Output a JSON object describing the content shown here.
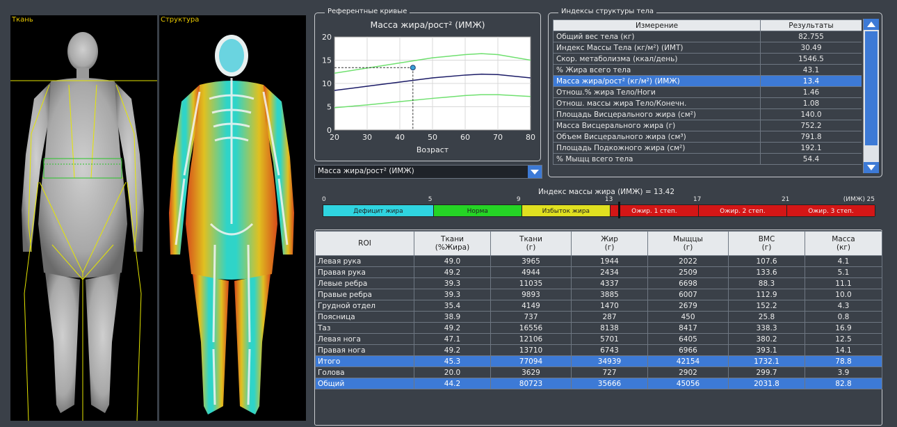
{
  "panels": {
    "tissue_label": "Ткань",
    "structure_label": "Структура"
  },
  "ref_curves": {
    "group_title": "Референтные кривые",
    "chart_title": "Масса жира/рост² (ИМЖ)",
    "xlabel": "Возраст",
    "xticks": [
      "20",
      "30",
      "40",
      "50",
      "60",
      "70",
      "80"
    ],
    "yticks": [
      "0",
      "5",
      "10",
      "15",
      "20"
    ]
  },
  "chart_data": {
    "type": "line",
    "title": "Масса жира/рост² (ИМЖ)",
    "xlabel": "Возраст",
    "ylabel": "",
    "xlim": [
      20,
      80
    ],
    "ylim": [
      0,
      20
    ],
    "x": [
      20,
      30,
      40,
      50,
      60,
      65,
      70,
      80
    ],
    "series": [
      {
        "values": [
          12.2,
          13.3,
          14.4,
          15.5,
          16.2,
          16.4,
          16.2,
          15.0
        ],
        "color": "#6fe06f"
      },
      {
        "values": [
          8.5,
          9.4,
          10.3,
          11.2,
          11.8,
          12.0,
          11.9,
          11.2
        ],
        "color": "#1a1a66"
      },
      {
        "values": [
          4.8,
          5.4,
          6.1,
          6.8,
          7.4,
          7.6,
          7.6,
          7.2
        ],
        "color": "#6fe06f"
      }
    ],
    "patient_point": {
      "x": 44,
      "y": 13.4
    },
    "grid": true
  },
  "dropdown": {
    "value": "Масса жира/рост² (ИМЖ)"
  },
  "indices": {
    "group_title": "Индексы структуры тела",
    "col_measure": "Измерение",
    "col_result": "Результаты",
    "rows": [
      {
        "name": "Общий вес тела (кг)",
        "value": "82.755"
      },
      {
        "name": "Индекс Массы Тела (кг/м²) (ИМТ)",
        "value": "30.49"
      },
      {
        "name": "Скор. метаболизма (ккал/день)",
        "value": "1546.5"
      },
      {
        "name": "% Жира всего тела",
        "value": "43.1"
      },
      {
        "name": "Масса жира/рост² (кг/м²) (ИМЖ)",
        "value": "13.4"
      },
      {
        "name": "Отнош.% жира Тело/Ноги",
        "value": "1.46"
      },
      {
        "name": "Отнош. массы жира Тело/Конечн.",
        "value": "1.08"
      },
      {
        "name": "Площадь Висцерального жира (см²)",
        "value": "140.0"
      },
      {
        "name": "Масса Висцерального жира (г)",
        "value": "752.2"
      },
      {
        "name": "Объем Висцерального жира (см³)",
        "value": "791.8"
      },
      {
        "name": "Площадь Подкожного жира (см²)",
        "value": "192.1"
      },
      {
        "name": "% Мыщц всего тела",
        "value": "54.4"
      }
    ]
  },
  "fat_scale": {
    "title": "Индекс массы жира (ИМЖ) = 13.42",
    "marker_value": 13.42,
    "unit": "(ИМЖ)",
    "ticks": [
      "0",
      "5",
      "9",
      "13",
      "17",
      "21",
      "25"
    ],
    "segments": [
      {
        "label": "Дефицит жира",
        "color": "#2fd4e0"
      },
      {
        "label": "Норма",
        "color": "#25d425"
      },
      {
        "label": "Избыток жира",
        "color": "#e0e020"
      },
      {
        "label": "Ожир. 1 степ.",
        "color": "#d41616"
      },
      {
        "label": "Ожир. 2 степ.",
        "color": "#d41616"
      },
      {
        "label": "Ожир. 3 степ.",
        "color": "#d41616"
      }
    ]
  },
  "roi": {
    "headers": [
      "ROI",
      "Ткани\n(%Жира)",
      "Ткани\n(г)",
      "Жир\n(г)",
      "Мыщцы\n(г)",
      "BMC\n(г)",
      "Масса\n(кг)"
    ],
    "rows": [
      [
        "Левая рука",
        "49.0",
        "3965",
        "1944",
        "2022",
        "107.6",
        "4.1"
      ],
      [
        "Правая рука",
        "49.2",
        "4944",
        "2434",
        "2509",
        "133.6",
        "5.1"
      ],
      [
        "Левые ребра",
        "39.3",
        "11035",
        "4337",
        "6698",
        "88.3",
        "11.1"
      ],
      [
        "Правые ребра",
        "39.3",
        "9893",
        "3885",
        "6007",
        "112.9",
        "10.0"
      ],
      [
        "Грудной отдел",
        "35.4",
        "4149",
        "1470",
        "2679",
        "152.2",
        "4.3"
      ],
      [
        "Поясница",
        "38.9",
        "737",
        "287",
        "450",
        "25.8",
        "0.8"
      ],
      [
        "Таз",
        "49.2",
        "16556",
        "8138",
        "8417",
        "338.3",
        "16.9"
      ],
      [
        "Левая нога",
        "47.1",
        "12106",
        "5701",
        "6405",
        "380.2",
        "12.5"
      ],
      [
        "Правая нога",
        "49.2",
        "13710",
        "6743",
        "6966",
        "393.1",
        "14.1"
      ],
      [
        "Итого",
        "45.3",
        "77094",
        "34939",
        "42154",
        "1732.1",
        "78.8"
      ],
      [
        "Голова",
        "20.0",
        "3629",
        "727",
        "2902",
        "299.7",
        "3.9"
      ],
      [
        "Общий",
        "44.2",
        "80723",
        "35666",
        "45056",
        "2031.8",
        "82.8"
      ]
    ]
  }
}
